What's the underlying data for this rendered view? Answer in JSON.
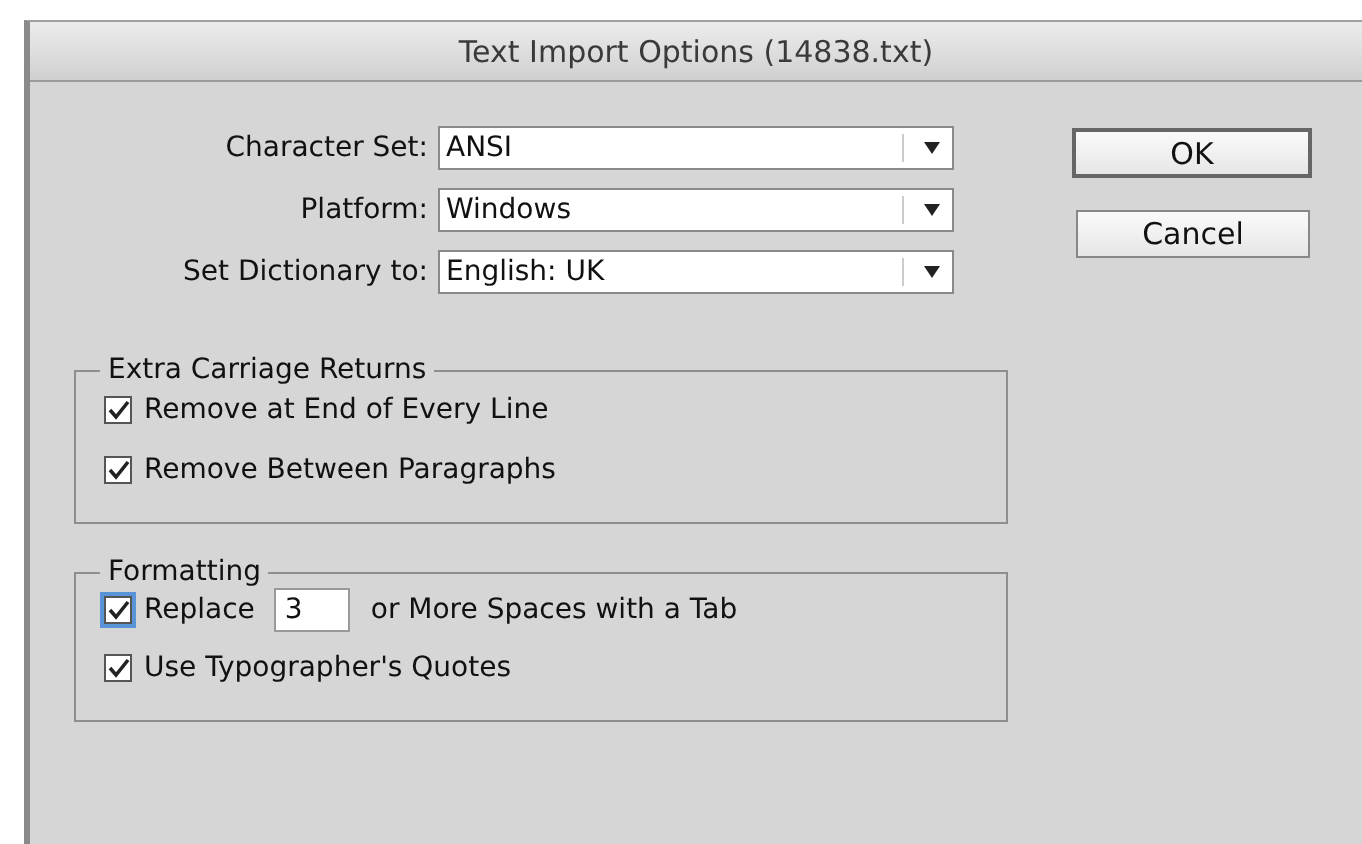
{
  "window": {
    "title": "Text Import Options (14838.txt)"
  },
  "selects": [
    {
      "label": "Character Set:",
      "value": "ANSI"
    },
    {
      "label": "Platform:",
      "value": "Windows"
    },
    {
      "label": "Set Dictionary to:",
      "value": "English: UK"
    }
  ],
  "buttons": [
    {
      "label": "OK",
      "default": true
    },
    {
      "label": "Cancel",
      "default": false
    }
  ],
  "groups": [
    {
      "title": "Extra Carriage Returns",
      "options": [
        {
          "kind": "check",
          "label": "Remove at End of Every Line",
          "checked": true
        },
        {
          "kind": "check",
          "label": "Remove Between Paragraphs",
          "checked": true
        }
      ]
    },
    {
      "title": "Formatting",
      "options": [
        {
          "kind": "check_field",
          "label": "Replace",
          "value": "3",
          "suffix": "or More Spaces with a Tab",
          "checked": true
        },
        {
          "kind": "check",
          "label": "Use Typographer's Quotes",
          "checked": true
        }
      ]
    }
  ]
}
